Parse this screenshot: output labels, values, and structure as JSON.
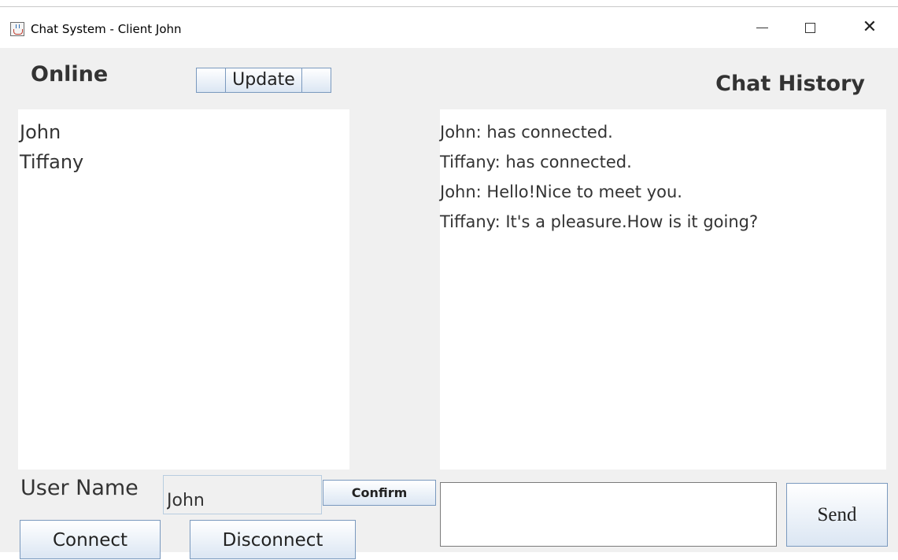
{
  "window": {
    "title": "Chat System - Client John",
    "icons": {
      "app": "java-cup-icon",
      "minimize": "minimize-icon",
      "maximize": "maximize-icon",
      "close": "close-icon"
    }
  },
  "online_panel": {
    "label": "Online",
    "update_label": "Update",
    "users": [
      "John",
      "Tiffany"
    ]
  },
  "chat_panel": {
    "label": "Chat History",
    "messages": [
      "John: has connected.",
      "Tiffany: has connected.",
      "John: Hello!Nice to meet you.",
      "Tiffany: It's a pleasure.How is it going?"
    ]
  },
  "user_form": {
    "label": "User Name",
    "value": "John",
    "confirm_label": "Confirm",
    "connect_label": "Connect",
    "disconnect_label": "Disconnect"
  },
  "message_form": {
    "value": "",
    "send_label": "Send"
  }
}
